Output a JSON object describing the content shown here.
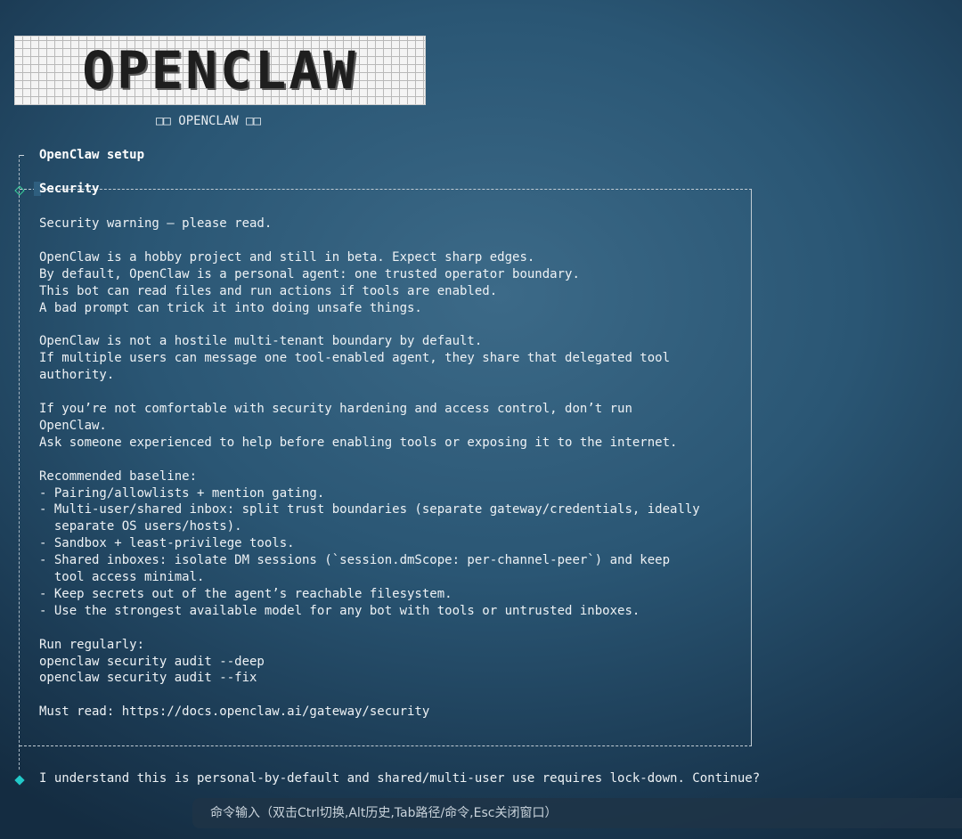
{
  "logo": {
    "text": "OPENCLAW",
    "caption": "□□ OPENCLAW □□"
  },
  "setup": {
    "title": "OpenClaw setup"
  },
  "security": {
    "title": "Security",
    "lines": [
      "Security warning — please read.",
      "",
      "OpenClaw is a hobby project and still in beta. Expect sharp edges.",
      "By default, OpenClaw is a personal agent: one trusted operator boundary.",
      "This bot can read files and run actions if tools are enabled.",
      "A bad prompt can trick it into doing unsafe things.",
      "",
      "OpenClaw is not a hostile multi-tenant boundary by default.",
      "If multiple users can message one tool-enabled agent, they share that delegated tool",
      "authority.",
      "",
      "If you’re not comfortable with security hardening and access control, don’t run",
      "OpenClaw.",
      "Ask someone experienced to help before enabling tools or exposing it to the internet.",
      "",
      "Recommended baseline:",
      "- Pairing/allowlists + mention gating.",
      "- Multi-user/shared inbox: split trust boundaries (separate gateway/credentials, ideally",
      "  separate OS users/hosts).",
      "- Sandbox + least-privilege tools.",
      "- Shared inboxes: isolate DM sessions (`session.dmScope: per-channel-peer`) and keep",
      "  tool access minimal.",
      "- Keep secrets out of the agent’s reachable filesystem.",
      "- Use the strongest available model for any bot with tools or untrusted inboxes.",
      "",
      "Run regularly:",
      "openclaw security audit --deep",
      "openclaw security audit --fix",
      "",
      "Must read: https://docs.openclaw.ai/gateway/security"
    ]
  },
  "prompt": {
    "text": "I understand this is personal-by-default and shared/multi-user use requires lock-down. Continue?"
  },
  "command_bar": {
    "text": "命令输入（双击Ctrl切换,Alt历史,Tab路径/命令,Esc关闭窗口）"
  },
  "colors": {
    "accent_diamond": "#3bd39b",
    "prompt_diamond": "#22c9c9"
  }
}
